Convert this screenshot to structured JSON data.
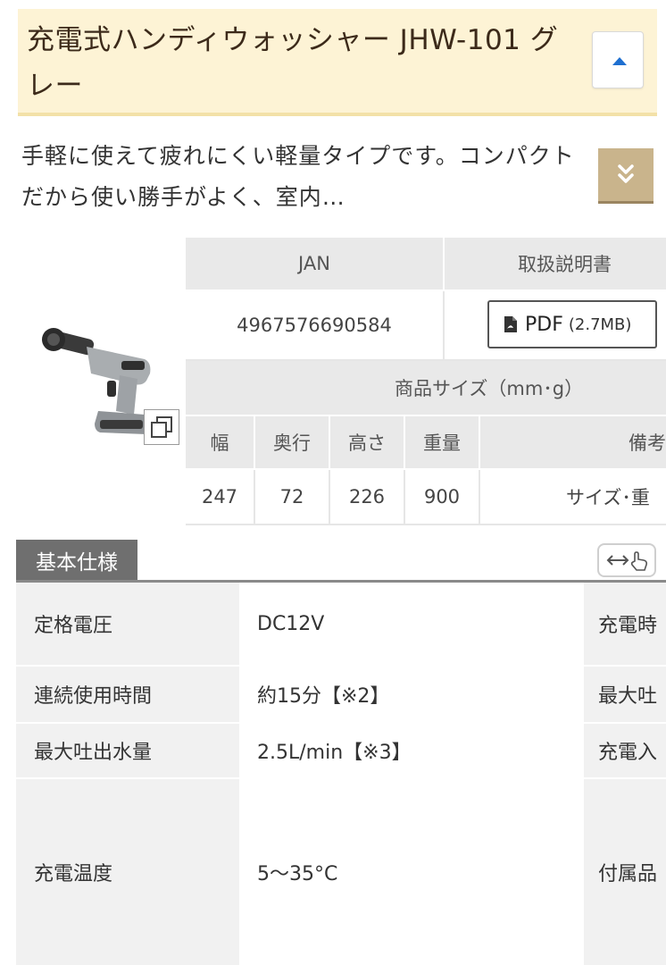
{
  "header": {
    "title": "充電式ハンディウォッシャー JHW-101 グレー",
    "up_button_icon": "caret-up-icon"
  },
  "description": {
    "text": "手軽に使えて疲れにくい軽量タイプです。コンパクトだから使い勝手がよく、室内…",
    "expand_icon": "double-chevron-down-icon"
  },
  "product_info": {
    "jan_header": "JAN",
    "manual_header": "取扱説明書",
    "jan_value": "4967576690584",
    "pdf_label": "PDF",
    "pdf_size": "(2.7MB)",
    "size_header": "商品サイズ（mm･g）",
    "size_columns": [
      "幅",
      "奥行",
      "高さ",
      "重量",
      "備考"
    ],
    "size_values": [
      "247",
      "72",
      "226",
      "900",
      "サイズ･重"
    ]
  },
  "spec": {
    "tab_label": "基本仕様",
    "rows": [
      {
        "key": "定格電圧",
        "value": "DC12V",
        "key2": "充電時"
      },
      {
        "key": "連続使用時間",
        "value": "約15分【※2】",
        "key2": "最大吐"
      },
      {
        "key": "最大吐出水量",
        "value": "2.5L/min【※3】",
        "key2": "充電入"
      },
      {
        "key": "充電温度",
        "value": "5〜35°C",
        "key2": "付属品"
      }
    ]
  },
  "colors": {
    "title_bg": "#fdf3d5",
    "accent_gold": "#c9b48c",
    "link_blue": "#1e6fd0",
    "header_gray": "#e9e9e9",
    "tab_gray": "#6f6f6f"
  }
}
